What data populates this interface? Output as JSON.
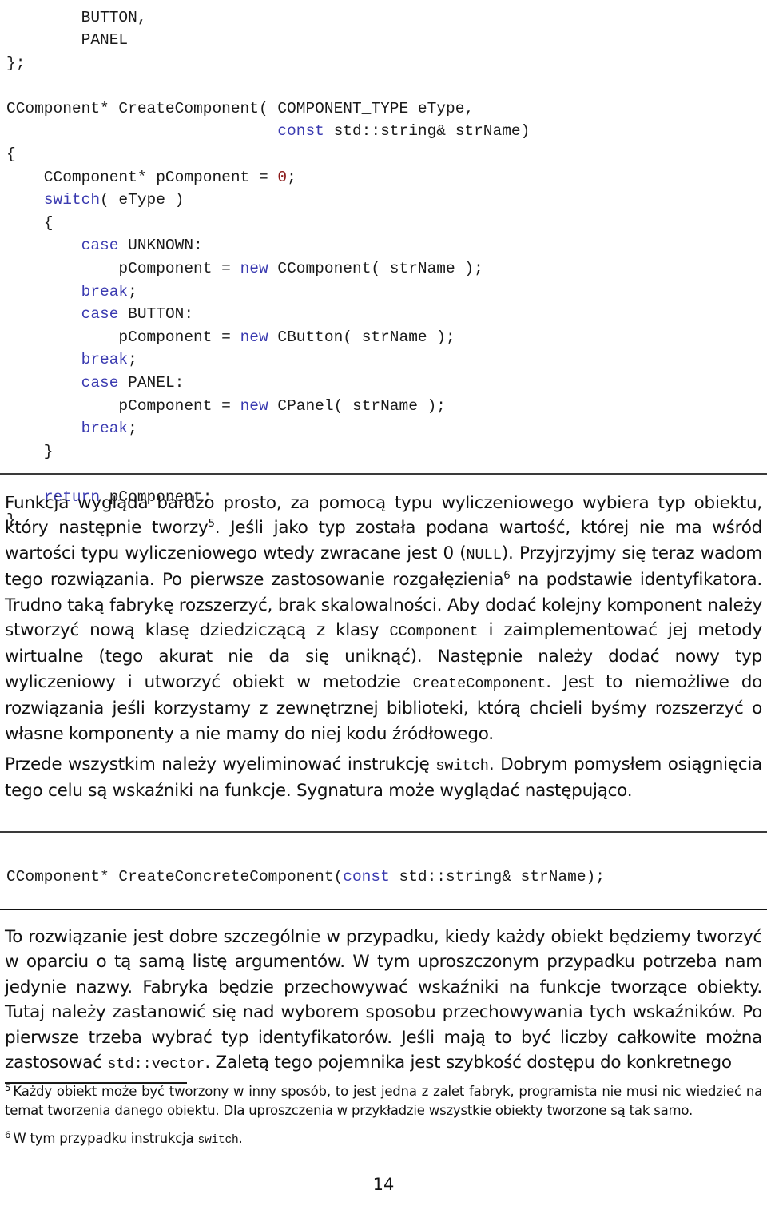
{
  "document": {
    "page_number": "14",
    "language": "pl"
  },
  "code_top": {
    "language": "cpp",
    "lines": [
      [
        {
          "t": "        BUTTON,",
          "c": "plain"
        }
      ],
      [
        {
          "t": "        PANEL",
          "c": "plain"
        }
      ],
      [
        {
          "t": "};",
          "c": "plain"
        }
      ],
      [
        {
          "t": "",
          "c": "plain"
        }
      ],
      [
        {
          "t": "CComponent* CreateComponent( COMPONENT_TYPE eType,",
          "c": "plain"
        }
      ],
      [
        {
          "t": "                             ",
          "c": "plain"
        },
        {
          "t": "const",
          "c": "kw"
        },
        {
          "t": " std::string& strName)",
          "c": "plain"
        }
      ],
      [
        {
          "t": "{",
          "c": "plain"
        }
      ],
      [
        {
          "t": "    CComponent* pComponent = ",
          "c": "plain"
        },
        {
          "t": "0",
          "c": "num"
        },
        {
          "t": ";",
          "c": "plain"
        }
      ],
      [
        {
          "t": "    ",
          "c": "plain"
        },
        {
          "t": "switch",
          "c": "kw"
        },
        {
          "t": "( eType )",
          "c": "plain"
        }
      ],
      [
        {
          "t": "    {",
          "c": "plain"
        }
      ],
      [
        {
          "t": "        ",
          "c": "plain"
        },
        {
          "t": "case",
          "c": "kw"
        },
        {
          "t": " UNKNOWN:",
          "c": "plain"
        }
      ],
      [
        {
          "t": "            pComponent = ",
          "c": "plain"
        },
        {
          "t": "new",
          "c": "kw"
        },
        {
          "t": " CComponent( strName );",
          "c": "plain"
        }
      ],
      [
        {
          "t": "        ",
          "c": "plain"
        },
        {
          "t": "break",
          "c": "kw"
        },
        {
          "t": ";",
          "c": "plain"
        }
      ],
      [
        {
          "t": "        ",
          "c": "plain"
        },
        {
          "t": "case",
          "c": "kw"
        },
        {
          "t": " BUTTON:",
          "c": "plain"
        }
      ],
      [
        {
          "t": "            pComponent = ",
          "c": "plain"
        },
        {
          "t": "new",
          "c": "kw"
        },
        {
          "t": " CButton( strName );",
          "c": "plain"
        }
      ],
      [
        {
          "t": "        ",
          "c": "plain"
        },
        {
          "t": "break",
          "c": "kw"
        },
        {
          "t": ";",
          "c": "plain"
        }
      ],
      [
        {
          "t": "        ",
          "c": "plain"
        },
        {
          "t": "case",
          "c": "kw"
        },
        {
          "t": " PANEL:",
          "c": "plain"
        }
      ],
      [
        {
          "t": "            pComponent = ",
          "c": "plain"
        },
        {
          "t": "new",
          "c": "kw"
        },
        {
          "t": " CPanel( strName );",
          "c": "plain"
        }
      ],
      [
        {
          "t": "        ",
          "c": "plain"
        },
        {
          "t": "break",
          "c": "kw"
        },
        {
          "t": ";",
          "c": "plain"
        }
      ],
      [
        {
          "t": "    }",
          "c": "plain"
        }
      ],
      [
        {
          "t": "",
          "c": "plain"
        }
      ],
      [
        {
          "t": "    ",
          "c": "plain"
        },
        {
          "t": "return",
          "c": "kw"
        },
        {
          "t": " pComponent;",
          "c": "plain"
        }
      ],
      [
        {
          "t": "}",
          "c": "plain"
        }
      ]
    ]
  },
  "code_mid": {
    "language": "cpp",
    "lines": [
      [
        {
          "t": "CComponent* CreateConcreteComponent(",
          "c": "plain"
        },
        {
          "t": "const",
          "c": "kw"
        },
        {
          "t": " std::string& strName);",
          "c": "plain"
        }
      ]
    ]
  },
  "paragraphs": {
    "p1": [
      {
        "t": "Funkcja wygląda bardzo prosto, za pomocą typu wyliczeniowego wybiera typ obiektu, który następnie tworzy",
        "k": "text"
      },
      {
        "t": "5",
        "k": "sup"
      },
      {
        "t": ". Jeśli jako typ została podana wartość, której nie ma wśród wartości typu wyliczeniowego wtedy zwracane jest 0 (",
        "k": "text"
      },
      {
        "t": "NULL",
        "k": "mono"
      },
      {
        "t": "). Przyjrzyjmy się teraz wadom tego rozwiązania. Po pierwsze zastosowanie rozgałęzienia",
        "k": "text"
      },
      {
        "t": "6",
        "k": "sup"
      },
      {
        "t": " na podstawie identyfikatora. Trudno taką fabrykę rozszerzyć, brak skalowalności. Aby dodać kolejny komponent należy stworzyć nową klasę dziedziczącą z klasy ",
        "k": "text"
      },
      {
        "t": "CComponent",
        "k": "mono"
      },
      {
        "t": " i zaimplementować jej metody wirtualne (tego akurat nie da się uniknąć). Następnie należy dodać nowy typ wyliczeniowy i utworzyć obiekt w metodzie ",
        "k": "text"
      },
      {
        "t": "CreateComponent",
        "k": "mono"
      },
      {
        "t": ". Jest to niemożliwe do rozwiązania jeśli korzystamy z zewnętrznej biblioteki, którą chcieli byśmy rozszerzyć o własne komponenty a nie mamy do niej kodu źródłowego.",
        "k": "text"
      }
    ],
    "p2": [
      {
        "t": "Przede wszystkim należy wyeliminować instrukcję ",
        "k": "text"
      },
      {
        "t": "switch",
        "k": "mono"
      },
      {
        "t": ". Dobrym pomysłem osiągnięcia tego celu są wskaźniki na funkcje. Sygnatura może wyglądać następująco.",
        "k": "text"
      }
    ],
    "p3": [
      {
        "t": "To rozwiązanie jest dobre szczególnie w przypadku, kiedy każdy obiekt będziemy tworzyć w oparciu o tą samą listę argumentów. W tym uproszczonym przypadku potrzeba nam jedynie nazwy. Fabryka będzie przechowywać wskaźniki na funkcje tworzące obiekty. Tutaj należy zastanowić się nad wyborem sposobu przechowywania tych wskaźników. Po pierwsze trzeba wybrać typ identyfikatorów. Jeśli mają to być liczby całkowite można zastosować ",
        "k": "text"
      },
      {
        "t": "std::vector",
        "k": "mono"
      },
      {
        "t": ". Zaletą tego pojemnika jest szybkość dostępu do konkretnego",
        "k": "text"
      }
    ]
  },
  "footnotes": [
    {
      "mark": "5",
      "parts": [
        {
          "t": "Każdy obiekt może być tworzony w inny sposób, to jest jedna z zalet fabryk, programista nie musi nic wiedzieć na temat tworzenia danego obiektu. Dla uproszczenia w przykładzie wszystkie obiekty tworzone są tak samo.",
          "k": "text"
        }
      ]
    },
    {
      "mark": "6",
      "parts": [
        {
          "t": "W tym przypadku instrukcja ",
          "k": "text"
        },
        {
          "t": "switch",
          "k": "mono"
        },
        {
          "t": ".",
          "k": "text"
        }
      ]
    }
  ],
  "colors": {
    "keyword": "#3a3ab0",
    "number": "#8b1a1a",
    "text": "#111111",
    "rule": "#3a3a3a"
  }
}
